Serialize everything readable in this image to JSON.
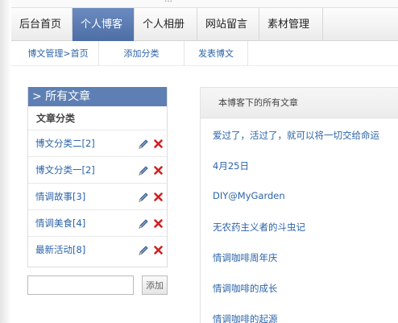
{
  "top_strip_text": "…",
  "main_nav": {
    "tabs": [
      {
        "label": "后台首页"
      },
      {
        "label": "个人博客"
      },
      {
        "label": "个人相册"
      },
      {
        "label": "网站留言"
      },
      {
        "label": "素材管理"
      }
    ],
    "active_index": 1,
    "active_color": "#5a7bb1"
  },
  "sub_nav": {
    "items": [
      {
        "label": "博文管理>首页"
      },
      {
        "label": "添加分类"
      },
      {
        "label": "发表博文"
      }
    ]
  },
  "categories_panel": {
    "title": "> 所有文章",
    "subtitle": "文章分类",
    "items": [
      {
        "label": "博文分类二[2]"
      },
      {
        "label": "博文分类一[2]"
      },
      {
        "label": "情调故事[3]"
      },
      {
        "label": "情调美食[4]"
      },
      {
        "label": "最新活动[8]"
      }
    ],
    "edit_icon": "pencil-icon",
    "delete_icon": "delete-x-icon",
    "delete_color": "#d22020"
  },
  "add_category": {
    "input_value": "",
    "button_label": "添加"
  },
  "posts_panel": {
    "header": "本博客下的所有文章",
    "posts": [
      {
        "title": "爱过了，活过了，就可以将一切交给命运"
      },
      {
        "title": "4月25日"
      },
      {
        "title": "DIY@MyGarden"
      },
      {
        "title": "无农药主义者的斗虫记"
      },
      {
        "title": "情调咖啡周年庆"
      },
      {
        "title": "情调咖啡的成长"
      },
      {
        "title": "情调咖啡的起源"
      }
    ]
  },
  "link_color": "#2c64a8"
}
